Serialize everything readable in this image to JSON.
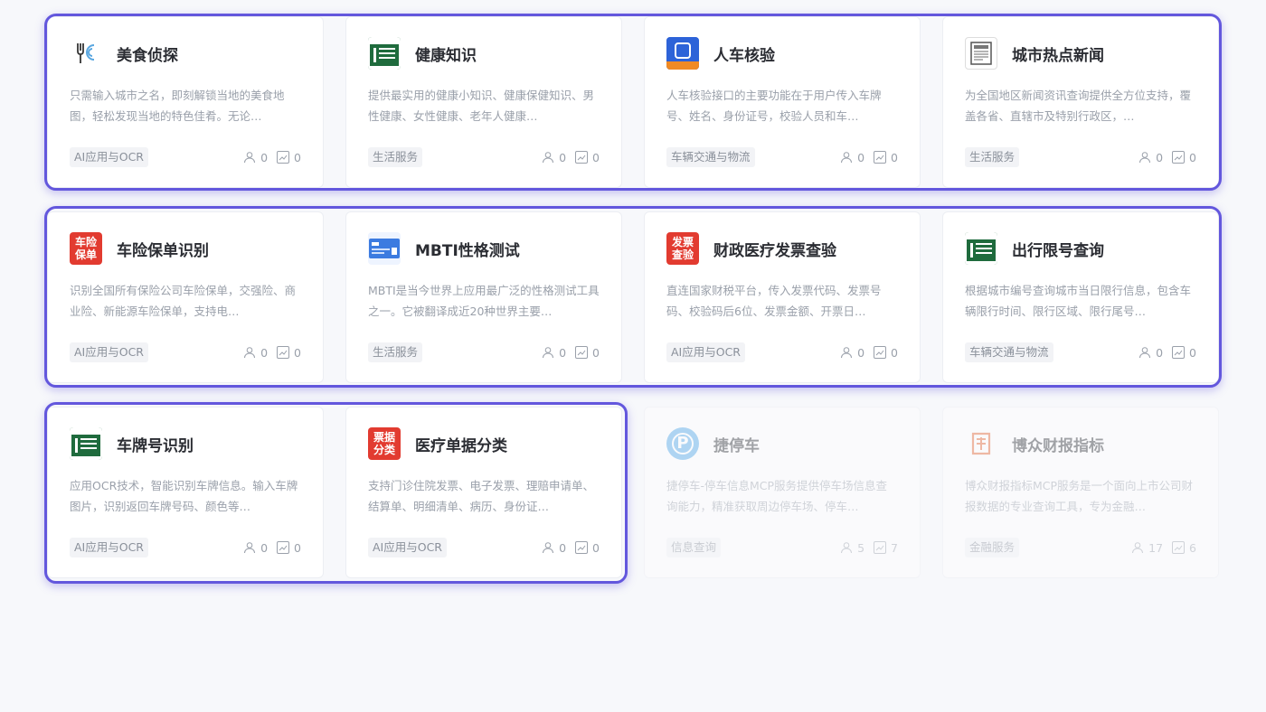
{
  "cards": [
    {
      "title": "美食侦探",
      "desc": "只需输入城市之名，即刻解锁当地的美食地图，轻松发现当地的特色佳肴。无论…",
      "tag": "AI应用与OCR",
      "users": "0",
      "calls": "0",
      "icon": "fork-icon",
      "icon_text": ""
    },
    {
      "title": "健康知识",
      "desc": "提供最实用的健康小知识、健康保健知识、男性健康、女性健康、老年人健康…",
      "tag": "生活服务",
      "users": "0",
      "calls": "0",
      "icon": "health-icon",
      "icon_text": ""
    },
    {
      "title": "人车核验",
      "desc": "人车核验接口的主要功能在于用户传入车牌号、姓名、身份证号，校验人员和车…",
      "tag": "车辆交通与物流",
      "users": "0",
      "calls": "0",
      "icon": "vehicle-id-icon",
      "icon_text": ""
    },
    {
      "title": "城市热点新闻",
      "desc": "为全国地区新闻资讯查询提供全方位支持，覆盖各省、直辖市及特别行政区，…",
      "tag": "生活服务",
      "users": "0",
      "calls": "0",
      "icon": "newspaper-icon",
      "icon_text": ""
    },
    {
      "title": "车险保单识别",
      "desc": "识别全国所有保险公司车险保单，交强险、商业险、新能源车险保单，支持电…",
      "tag": "AI应用与OCR",
      "users": "0",
      "calls": "0",
      "icon": "insurance-icon",
      "icon_text": "车险\n保单"
    },
    {
      "title": "MBTI性格测试",
      "desc": "MBTI是当今世界上应用最广泛的性格测试工具之一。它被翻译成近20种世界主要…",
      "tag": "生活服务",
      "users": "0",
      "calls": "0",
      "icon": "card-icon",
      "icon_text": ""
    },
    {
      "title": "财政医疗发票查验",
      "desc": "直连国家财税平台，传入发票代码、发票号码、校验码后6位、发票金额、开票日…",
      "tag": "AI应用与OCR",
      "users": "0",
      "calls": "0",
      "icon": "invoice-icon",
      "icon_text": "发票\n查验"
    },
    {
      "title": "出行限号查询",
      "desc": "根据城市编号查询城市当日限行信息，包含车辆限行时间、限行区域、限行尾号…",
      "tag": "车辆交通与物流",
      "users": "0",
      "calls": "0",
      "icon": "traffic-sign-icon",
      "icon_text": ""
    },
    {
      "title": "车牌号识别",
      "desc": "应用OCR技术，智能识别车牌信息。输入车牌图片，识别返回车牌号码、颜色等…",
      "tag": "AI应用与OCR",
      "users": "0",
      "calls": "0",
      "icon": "traffic-sign-icon",
      "icon_text": ""
    },
    {
      "title": "医疗单据分类",
      "desc": "支持门诊住院发票、电子发票、理赔申请单、结算单、明细清单、病历、身份证…",
      "tag": "AI应用与OCR",
      "users": "0",
      "calls": "0",
      "icon": "medical-doc-icon",
      "icon_text": "票据\n分类"
    },
    {
      "title": "捷停车",
      "desc": "捷停车-停车信息MCP服务提供停车场信息查询能力，精准获取周边停车场、停车…",
      "tag": "信息查询",
      "users": "5",
      "calls": "7",
      "icon": "parking-icon",
      "icon_text": "P"
    },
    {
      "title": "博众财报指标",
      "desc": "博众财报指标MCP服务是一个面向上市公司财报数据的专业查询工具，专为金融…",
      "tag": "金融服务",
      "users": "17",
      "calls": "6",
      "icon": "finance-icon",
      "icon_text": ""
    }
  ],
  "colors": {
    "highlight": "#6357dd",
    "tag_bg": "#f2f3f6"
  }
}
